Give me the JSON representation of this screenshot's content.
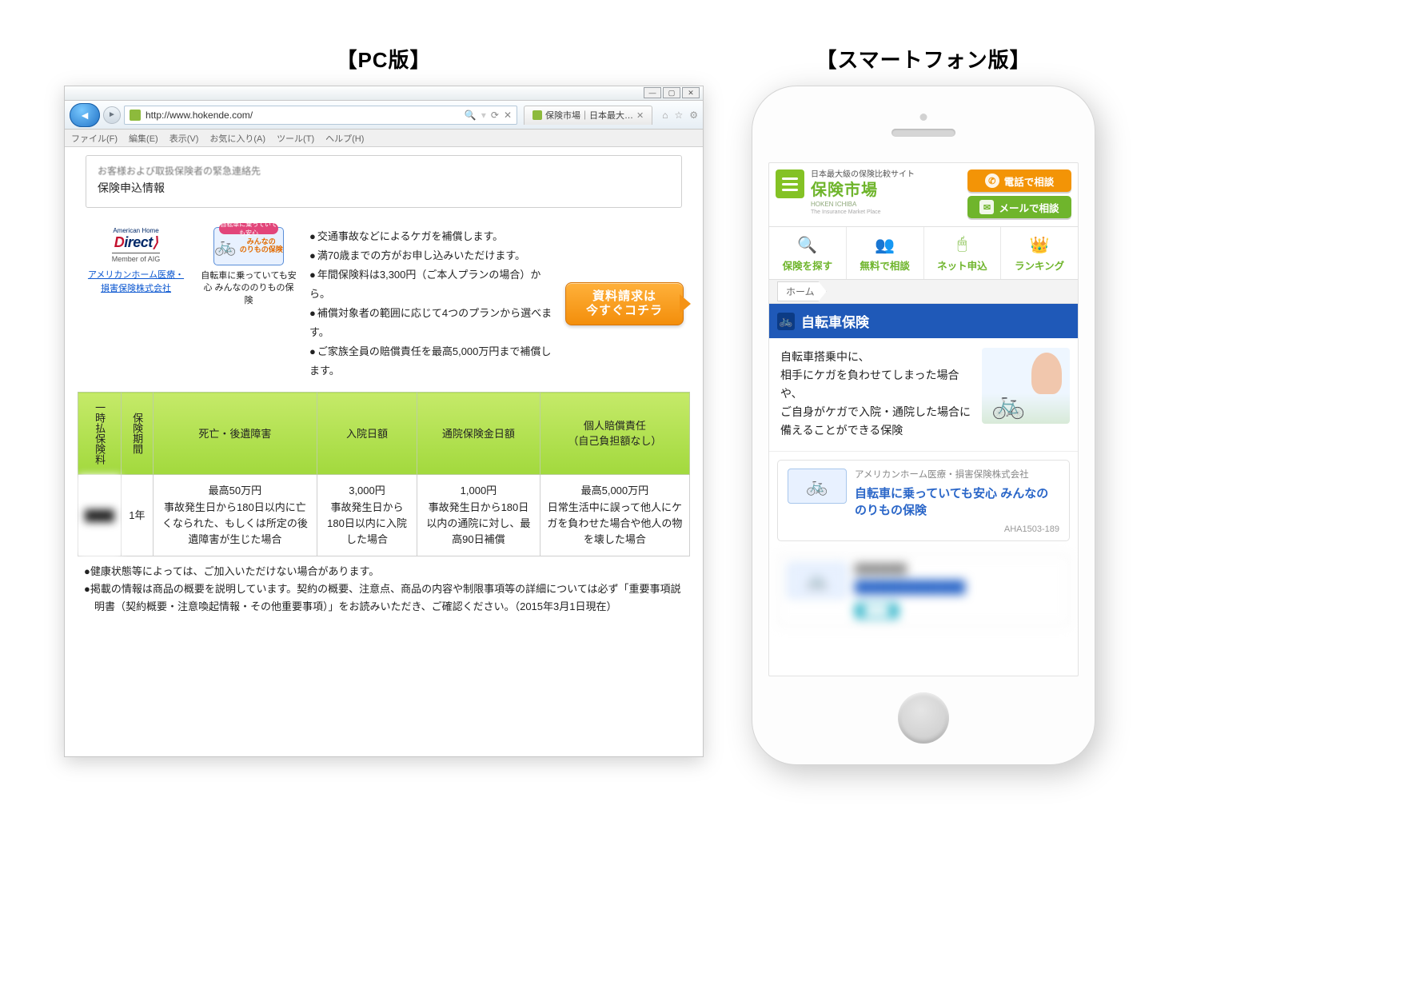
{
  "labels": {
    "pc": "【PC版】",
    "sp": "【スマートフォン版】"
  },
  "browser": {
    "window_buttons": {
      "min": "—",
      "max": "▢",
      "close": "✕"
    },
    "url": "http://www.hokende.com/",
    "search_icons": [
      "🔍",
      "⟳",
      "✕"
    ],
    "tab_title": "保険市場｜日本最大級の…",
    "toolbar_icons": [
      "⌂",
      "☆",
      "⚙"
    ],
    "menu": [
      "ファイル(F)",
      "編集(E)",
      "表示(V)",
      "お気に入り(A)",
      "ツール(T)",
      "ヘルプ(H)"
    ]
  },
  "page": {
    "top_truncated": "お客様および取扱保険者の緊急連絡先",
    "top_line": "保険申込情報",
    "brand": {
      "logo_top": "American Home",
      "logo_word": "Direct",
      "logo_sub": "Member of AIG",
      "link": "アメリカンホーム医療・損害保険株式会社"
    },
    "bike": {
      "pill": "自転車に乗っていても安心",
      "badge_text": "みんなの\nのりもの保険",
      "caption": "自転車に乗っていても安心 みんなののりもの保険"
    },
    "bullets": [
      "交通事故などによるケガを補償します。",
      "満70歳までの方がお申し込みいただけます。",
      "年間保険料は3,300円（ご本人プランの場合）から。",
      "補償対象者の範囲に応じて4つのプランから選べます。",
      "ご家族全員の賠償責任を最高5,000万円まで補償します。"
    ],
    "cta": {
      "line1": "資料請求は",
      "line2": "今すぐコチラ"
    },
    "table_headers": [
      "一時払保険料",
      "保険期間",
      "死亡・後遺障害",
      "入院日額",
      "通院保険金日額",
      "個人賠償責任\n（自己負担額なし）"
    ],
    "row": {
      "period": "1年",
      "c1_top": "最高50万円",
      "c1_body": "事故発生日から180日以内に亡くなられた、もしくは所定の後遺障害が生じた場合",
      "c2_top": "3,000円",
      "c2_body": "事故発生日から180日以内に入院した場合",
      "c3_top": "1,000円",
      "c3_body": "事故発生日から180日以内の通院に対し、最高90日補償",
      "c4_top": "最高5,000万円",
      "c4_body": "日常生活中に誤って他人にケガを負わせた場合や他人の物を壊した場合"
    },
    "notes": [
      "健康状態等によっては、ご加入いただけない場合があります。",
      "掲載の情報は商品の概要を説明しています。契約の概要、注意点、商品の内容や制限事項等の詳細については必ず「重要事項説明書（契約概要・注意喚起情報・その他重要事項）」をお読みいただき、ご確認ください。（2015年3月1日現在）"
    ]
  },
  "sp": {
    "tagline": "日本最大級の保険比較サイト",
    "logo": "保険市場",
    "logo_en": "HOKEN ICHIBA",
    "logo_tag": "The Insurance Market Place",
    "btn_tel": "電話で相談",
    "btn_mail": "メールで相談",
    "nav": [
      {
        "icon": "🔍",
        "label": "保険を探す"
      },
      {
        "icon": "👥",
        "label": "無料で相談"
      },
      {
        "icon": "🖱",
        "label": "ネット申込"
      },
      {
        "icon": "👑",
        "label": "ランキング"
      }
    ],
    "crumb": "ホーム",
    "section_title": "自転車保険",
    "hero_text": "自転車搭乗中に、\n相手にケガを負わせてしまった場合や、\nご自身がケガで入院・通院した場合に\n備えることができる保険",
    "card": {
      "company": "アメリカンホーム医療・損害保険株式会社",
      "name": "自転車に乗っていても安心 みんなののりもの保険",
      "code": "AHA1503-189"
    },
    "blurred_card": {
      "company": "████████",
      "name": "█████████████"
    }
  }
}
